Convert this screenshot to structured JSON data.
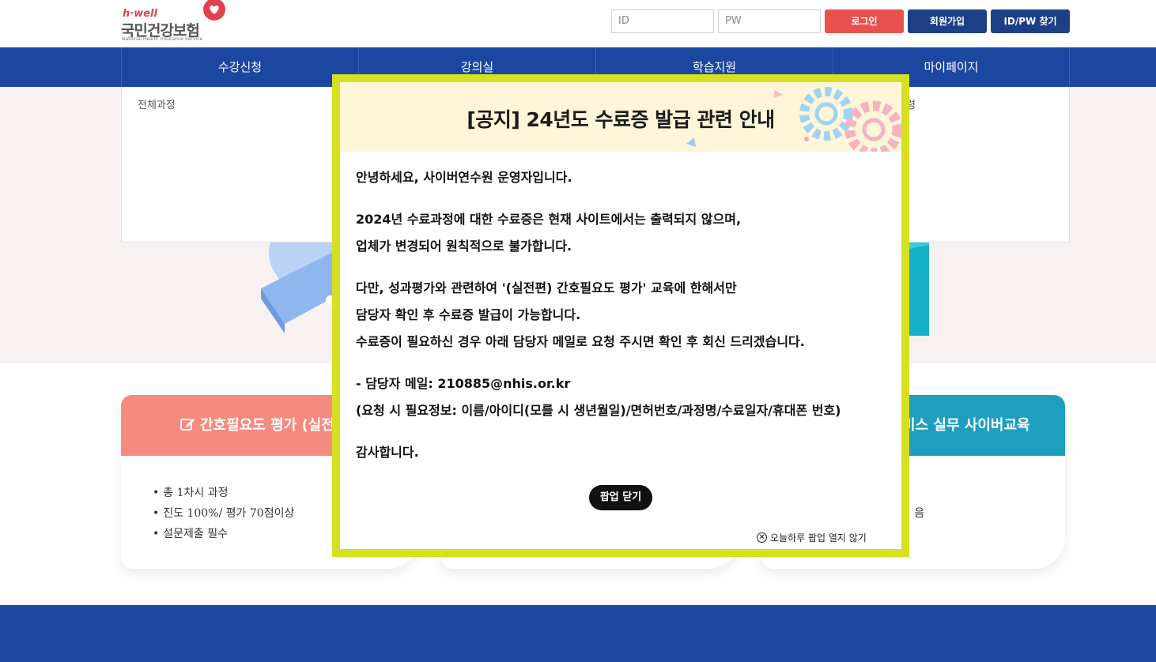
{
  "header": {
    "logo_top": "h·well",
    "logo_main": "국민건강보험",
    "logo_sub": "National Health Insurance Service",
    "id_placeholder": "ID",
    "pw_placeholder": "PW",
    "login_label": "로그인",
    "join_label": "회원가입",
    "find_label": "ID/PW 찾기"
  },
  "nav": {
    "items": [
      {
        "label": "수강신청"
      },
      {
        "label": "강의실"
      },
      {
        "label": "학습지원"
      },
      {
        "label": "마이페이지"
      }
    ]
  },
  "dropdown": {
    "item_all": "전체과정",
    "item_right_fragment": "령"
  },
  "cards": [
    {
      "title": "간호필요도 평가 (실전",
      "items": [
        "총 1차시 과정",
        "진도 100%/ 평가 70점이상",
        "설문제출 필수"
      ]
    },
    {
      "title": "",
      "items": []
    },
    {
      "title": "비스 실무 사이버교육",
      "items": [
        "",
        "음",
        ""
      ]
    }
  ],
  "popup": {
    "title": "[공지] 24년도 수료증 발급 관련 안내",
    "greeting": "안녕하세요, 사이버연수원 운영자입니다.",
    "para1_line1": "2024년 수료과정에 대한 수료증은 현재 사이트에서는 출력되지 않으며,",
    "para1_line2": "업체가 변경되어 원칙적으로 불가합니다.",
    "para2_prefix": "다만, 성과평가와 관련하여 ",
    "para2_bold": "'(실전편) 간호필요도 평가' 교육에 한해서만",
    "para2_line2": "담당자 확인 후 수료증 발급이 가능합니다.",
    "para2_line3": "수료증이 필요하신 경우 아래 담당자 메일로 요청 주시면 확인 후 회신 드리겠습니다.",
    "contact": "- 담당자 메일: 210885@nhis.or.kr",
    "required_info": "(요청 시 필요정보: 이름/아이디(모를 시 생년월일)/면허번호/과정명/수료일자/휴대폰 번호)",
    "thanks": "감사합니다.",
    "close_label": "팝업 닫기",
    "noshow_label": "오늘하루 팝업 열지 않기"
  },
  "colors": {
    "nav_blue": "#1c47a1",
    "login_red": "#e95050",
    "popup_border": "#d6e021",
    "card1_head": "#f58a7f",
    "card3_head": "#1e9fc0"
  }
}
